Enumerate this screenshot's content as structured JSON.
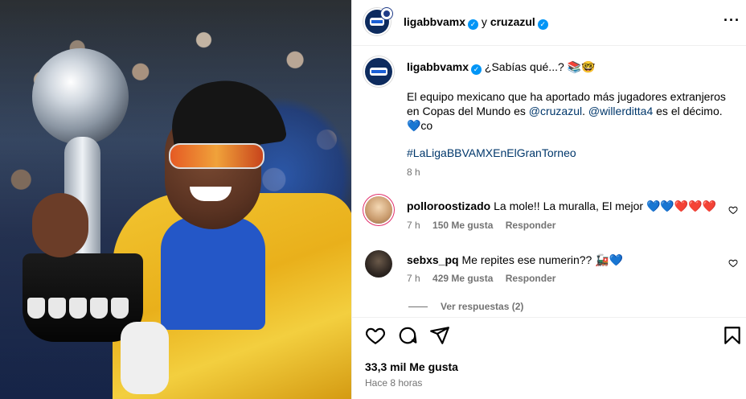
{
  "header": {
    "user1": "ligabbvamx",
    "joiner": "y",
    "user2": "cruzazul",
    "more_icon": "ellipsis-icon"
  },
  "caption": {
    "username": "ligabbvamx",
    "line1": "¿Sabías qué...? 📚🤓",
    "para_a": "El equipo mexicano que ha aportado más jugadores extranjeros en Copas del Mundo es ",
    "mention1": "@cruzazul",
    "para_b": ". ",
    "mention2": "@willerditta4",
    "para_c": " es el décimo.",
    "line_co": "💙co",
    "hashtag": "#LaLigaBBVAMXEnElGranTorneo",
    "time": "8 h"
  },
  "comments": [
    {
      "username": "polloroostizado",
      "text": "La mole!! La muralla, El mejor 💙💙❤️❤️❤️",
      "time": "7 h",
      "likes": "150 Me gusta",
      "reply": "Responder"
    },
    {
      "username": "sebxs_pq",
      "text": "Me repites ese numerin?? 🚂💙",
      "time": "7 h",
      "likes": "429 Me gusta",
      "reply": "Responder"
    }
  ],
  "view_replies": "Ver respuestas (2)",
  "actions": {
    "like_icon": "heart-icon",
    "comment_icon": "comment-icon",
    "share_icon": "send-icon",
    "save_icon": "bookmark-icon"
  },
  "likes_total": "33,3 mil Me gusta",
  "posted": "Hace 8 horas"
}
